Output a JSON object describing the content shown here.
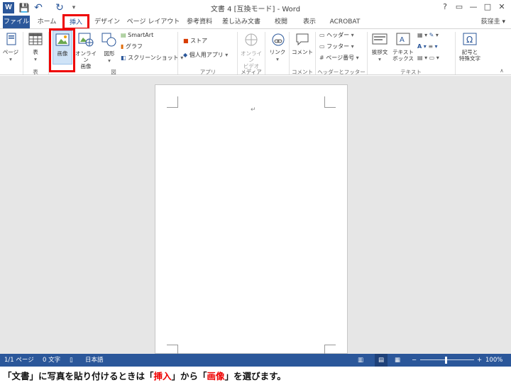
{
  "window": {
    "title": "文書 4 [互換モード] - Word",
    "logo": "W",
    "help_icon": "?",
    "restore_icon": "▭",
    "minimize_icon": "—",
    "maximize_icon": "□",
    "close_icon": "✕"
  },
  "qat": {
    "save_icon": "💾",
    "undo_icon": "↶",
    "redo_icon": "↻",
    "more_icon": "▾"
  },
  "tabs": [
    {
      "label": "ファイル"
    },
    {
      "label": "ホーム"
    },
    {
      "label": "挿入"
    },
    {
      "label": "デザイン"
    },
    {
      "label": "ページ レイアウト"
    },
    {
      "label": "参考資料"
    },
    {
      "label": "差し込み文書"
    },
    {
      "label": "校閲"
    },
    {
      "label": "表示"
    },
    {
      "label": "ACROBAT"
    }
  ],
  "user": {
    "name": "荻窪圭",
    "chevron": "▾"
  },
  "ribbon": {
    "pages": {
      "label": "ページ"
    },
    "table": {
      "label": "表",
      "group": "表"
    },
    "pictures": {
      "label": "画像"
    },
    "online_pictures": {
      "label1": "オンライン",
      "label2": "画像"
    },
    "shapes": {
      "label": "図形"
    },
    "smartart": "SmartArt",
    "chart": "グラフ",
    "screenshot": "スクリーンショット",
    "illustrations_group": "図",
    "store": "ストア",
    "my_apps": "個人用アプリ",
    "apps_group": "アプリ",
    "online_video": {
      "label1": "オンライン",
      "label2": "ビデオ"
    },
    "media_group": "メディア",
    "link": {
      "label": "リンク"
    },
    "comment": {
      "label": "コメント"
    },
    "comment_group": "コメント",
    "header": "ヘッダー",
    "footer": "フッター",
    "page_number": "ページ番号",
    "header_footer_group": "ヘッダーとフッター",
    "greeting": {
      "label": "挨拶文"
    },
    "textbox": {
      "label1": "テキスト",
      "label2": "ボックス"
    },
    "text_group": "テキスト",
    "symbols": {
      "label1": "記号と",
      "label2": "特殊文字"
    },
    "collapse_icon": "∧"
  },
  "document": {
    "paragraph_mark": "↵"
  },
  "status": {
    "page": "1/1 ページ",
    "words": "0 文字",
    "language": "日本語",
    "zoom": "100%",
    "zoom_minus": "−",
    "zoom_plus": "+"
  },
  "caption": {
    "part1": "「文書」に写真を貼り付けるときは「",
    "insert": "挿入",
    "part2": "」から「",
    "picture": "画像",
    "part3": "」を選びます。"
  },
  "colors": {
    "word_blue": "#2b579a",
    "highlight_red": "#e00000"
  }
}
